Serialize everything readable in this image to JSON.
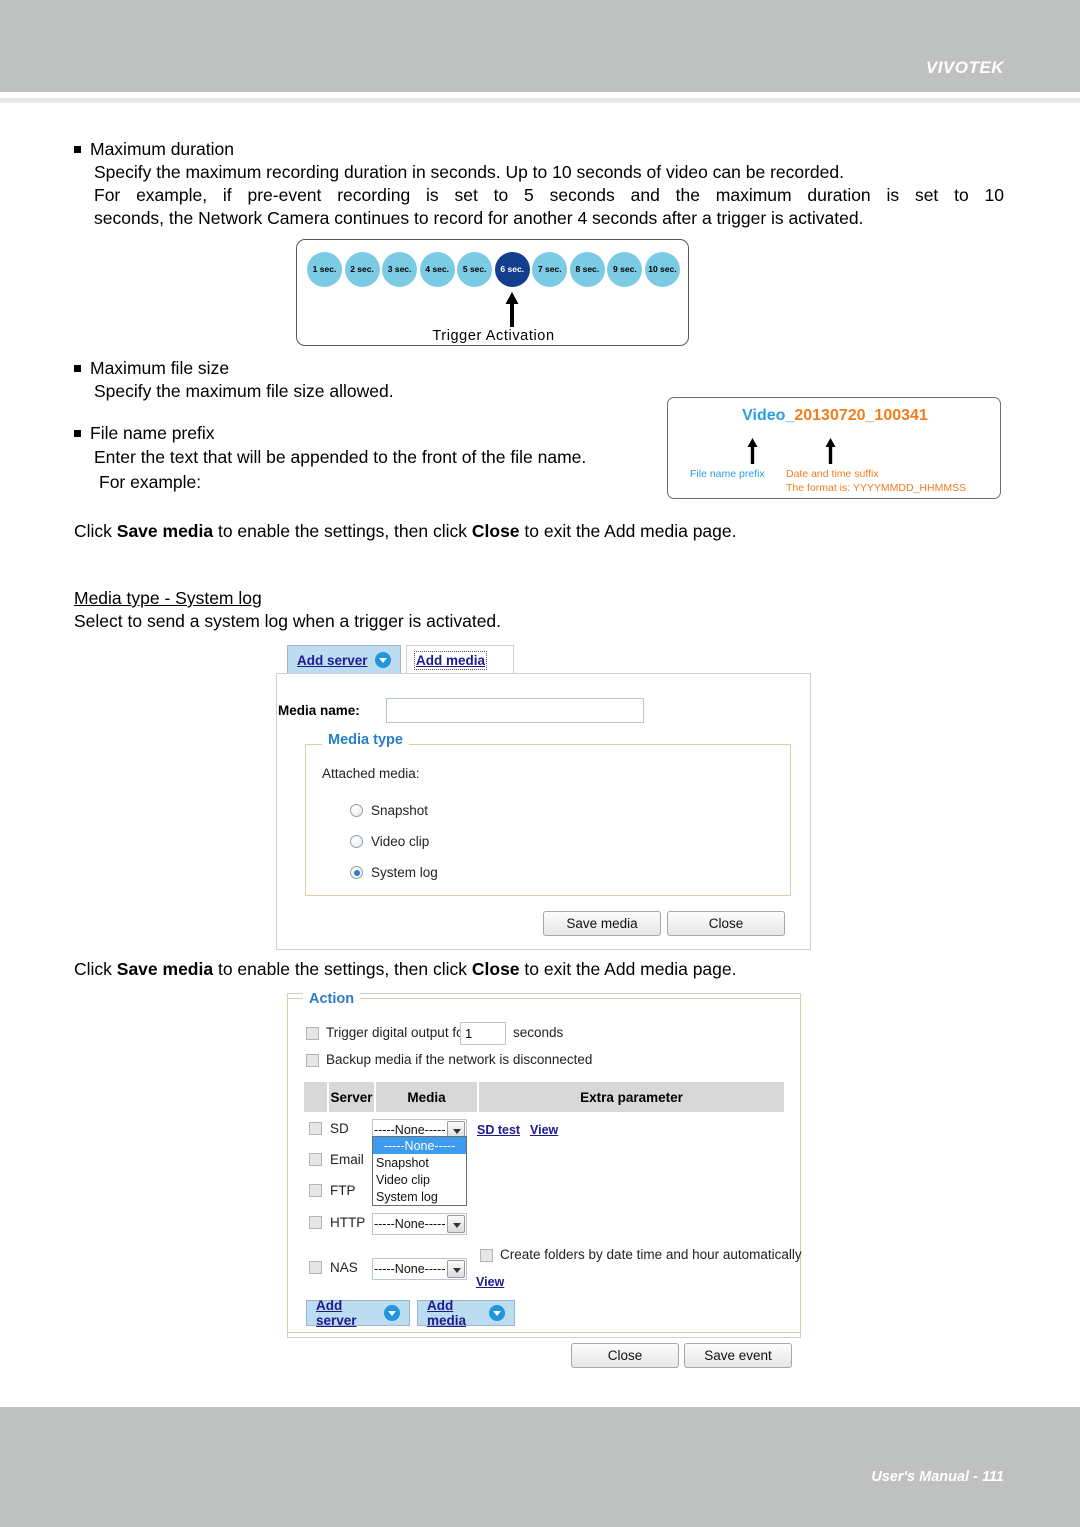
{
  "header": {
    "brand": "VIVOTEK"
  },
  "footer": {
    "text": "User's Manual - 111"
  },
  "sections": {
    "max_duration": {
      "title": "Maximum duration",
      "line1": "Specify the maximum recording duration in seconds. Up to 10 seconds of video can be recorded.",
      "line2": "For example, if pre-event recording is set to 5 seconds and the maximum duration is set to 10",
      "line3": "seconds, the Network Camera continues to record for another 4 seconds after a trigger is activated."
    },
    "max_file_size": {
      "title": "Maximum file size",
      "line1": "Specify the maximum file size allowed."
    },
    "file_name_prefix": {
      "title": "File name prefix",
      "line1": "Enter the text that will be appended to the front of the file name.",
      "line2": "For example:"
    },
    "media_type_system_log": {
      "title": "Media type - System log",
      "line1": "Select to send a system log when a trigger is activated."
    }
  },
  "click_note_1": {
    "pre": "Click ",
    "b1": "Save media",
    "mid": " to enable the settings, then click ",
    "b2": "Close",
    "post": " to exit the Add media page."
  },
  "click_note_2": {
    "pre": "Click ",
    "b1": "Save media",
    "mid": " to enable the settings, then click ",
    "b2": "Close",
    "post": " to exit the Add media page."
  },
  "timeline": {
    "seconds": [
      "1 sec.",
      "2 sec.",
      "3 sec.",
      "4 sec.",
      "5 sec.",
      "6 sec.",
      "7 sec.",
      "8 sec.",
      "9 sec.",
      "10 sec."
    ],
    "active_index": 5,
    "label": "Trigger Activation",
    "active_color": "#133e8e",
    "inactive_color": "#7ccbe4"
  },
  "filename_example": {
    "prefix": "Video_",
    "suffix": "20130720_100341",
    "prefix_label": "File name prefix",
    "suffix_label_line1": "Date and time suffix",
    "suffix_label_line2": "The format is: YYYYMMDD_HHMMSS",
    "prefix_color": "#2a9ee3",
    "suffix_color": "#f07e1c"
  },
  "add_media_dialog": {
    "tab_add_server": "Add server",
    "tab_add_media": "Add media",
    "media_name_label": "Media name:",
    "media_name_value": "",
    "media_type_legend": "Media type",
    "attached_media_label": "Attached media:",
    "options": [
      {
        "label": "Snapshot",
        "selected": false
      },
      {
        "label": "Video clip",
        "selected": false
      },
      {
        "label": "System log",
        "selected": true
      }
    ],
    "save_button": "Save media",
    "close_button": "Close"
  },
  "action_panel": {
    "legend": "Action",
    "trigger_output": {
      "checked": false,
      "text_before": "Trigger digital output for",
      "value": "1",
      "text_after": "seconds"
    },
    "backup_media": {
      "checked": false,
      "label": "Backup media if the network is disconnected"
    },
    "table_headers": [
      "",
      "Server",
      "Media",
      "Extra parameter"
    ],
    "rows": [
      {
        "server": "SD",
        "checked": false,
        "media": "-----None-----",
        "links": [
          "SD test",
          "View"
        ]
      },
      {
        "server": "Email",
        "checked": false,
        "media": "-----None-----",
        "links": []
      },
      {
        "server": "FTP",
        "checked": false,
        "media": "-----None-----",
        "links": []
      },
      {
        "server": "HTTP",
        "checked": false,
        "media": "-----None-----",
        "links": []
      },
      {
        "server": "NAS",
        "checked": false,
        "media": "-----None-----",
        "links": [
          "View"
        ]
      }
    ],
    "open_dropdown": {
      "row": "SD",
      "items": [
        "-----None-----",
        "Snapshot",
        "Video clip",
        "System log"
      ],
      "selected_index": 0
    },
    "nas_create_folders": {
      "checked": false,
      "label": "Create folders by date time and hour automatically"
    },
    "add_server_button": "Add server",
    "add_media_button": "Add media",
    "close_button": "Close",
    "save_event_button": "Save event"
  }
}
